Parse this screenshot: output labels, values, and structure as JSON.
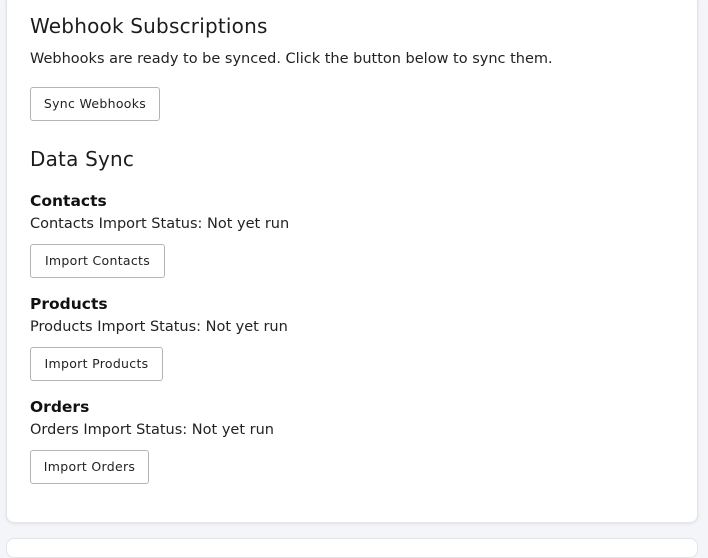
{
  "webhooks": {
    "title": "Webhook Subscriptions",
    "description": "Webhooks are ready to be synced. Click the button below to sync them.",
    "sync_button": "Sync Webhooks"
  },
  "data_sync": {
    "title": "Data Sync",
    "sections": [
      {
        "title": "Contacts",
        "status": "Contacts Import Status: Not yet run",
        "button": "Import Contacts"
      },
      {
        "title": "Products",
        "status": "Products Import Status: Not yet run",
        "button": "Import Products"
      },
      {
        "title": "Orders",
        "status": "Orders Import Status: Not yet run",
        "button": "Import Orders"
      }
    ]
  }
}
